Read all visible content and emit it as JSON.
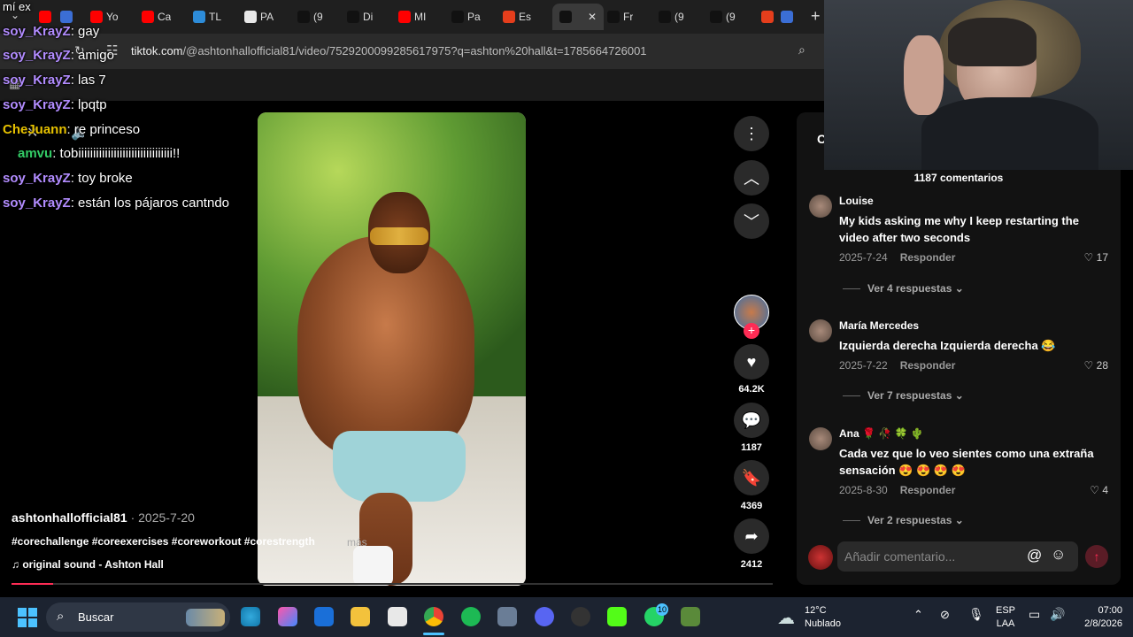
{
  "browser": {
    "tabs": [
      {
        "label": "",
        "color": "#ff0000"
      },
      {
        "label": "",
        "color": "#3b6ed5"
      },
      {
        "label": "Yo",
        "color": "#ff0000"
      },
      {
        "label": "Ca",
        "color": "#ff0000"
      },
      {
        "label": "TL",
        "color": "#2d8cd9"
      },
      {
        "label": "PA",
        "color": "#e8e8e8"
      },
      {
        "label": "(9",
        "color": "#111111"
      },
      {
        "label": "Di",
        "color": "#111111"
      },
      {
        "label": "MI",
        "color": "#ff0000"
      },
      {
        "label": "Pa",
        "color": "#111111"
      },
      {
        "label": "Es",
        "color": "#e53e1c"
      },
      {
        "label": "",
        "color": "#111111"
      },
      {
        "label": "Fr",
        "color": "#111111"
      },
      {
        "label": "(9",
        "color": "#111111"
      },
      {
        "label": "(9",
        "color": "#111111"
      },
      {
        "label": "",
        "color": "#e53e1c"
      },
      {
        "label": "",
        "color": "#3b6ed5"
      }
    ],
    "url_host": "tiktok.com",
    "url_path": "/@ashtonhallofficial81/video/7529200099285617975?q=ashton%20hall&t=1785664726001"
  },
  "chat": [
    {
      "user": "mí ex",
      "text": "",
      "color": "#ffffff"
    },
    {
      "user": "soy_KrayZ",
      "text": ": gay",
      "color": "#b28cff"
    },
    {
      "user": "soy_KrayZ",
      "text": ": amigo",
      "color": "#b28cff"
    },
    {
      "user": "soy_KrayZ",
      "text": ": las 7",
      "color": "#b28cff"
    },
    {
      "user": "soy_KrayZ",
      "text": ": lpqtp",
      "color": "#b28cff"
    },
    {
      "user": "CheJuann",
      "text": ": re princeso",
      "color": "#e6c100"
    },
    {
      "user": "amvu",
      "text": ": tobiiiiiiiiiiiiiiiiiiiiiiiiiiiiiiii!!",
      "color": "#33cc66"
    },
    {
      "user": "soy_KrayZ",
      "text": ": toy broke",
      "color": "#b28cff"
    },
    {
      "user": "soy_KrayZ",
      "text": ": están los pájaros cantndo",
      "color": "#b28cff"
    }
  ],
  "video": {
    "author": "ashtonhallofficial81",
    "date": " · 2025-7-20",
    "hashtags": "#corechallenge #coreexercises #coreworkout #corestrength",
    "more": "más",
    "sound": "original sound - Ashton Hall",
    "progress": 0.055
  },
  "actions": {
    "likes": "64.2K",
    "comments": "1187",
    "saves": "4369",
    "shares": "2412"
  },
  "comments_panel": {
    "header_letter": "C",
    "count_label": "1187 comentarios",
    "items": [
      {
        "user": "Louise",
        "text": "My kids asking me why I keep restarting the video after two seconds",
        "date": "2025-7-24",
        "reply": "Responder",
        "likes": "17",
        "more": "Ver 4 respuestas ⌄"
      },
      {
        "user": "María Mercedes",
        "text": "Izquierda derecha Izquierda derecha 😂",
        "date": "2025-7-22",
        "reply": "Responder",
        "likes": "28",
        "more": "Ver 7 respuestas ⌄"
      },
      {
        "user": "Ana 🌹 🥀 🍀 🌵",
        "text": "Cada vez que lo veo sientes como una extraña sensación 😍 😍 😍 😍",
        "date": "2025-8-30",
        "reply": "Responder",
        "likes": "4",
        "more": "Ver 2 respuestas ⌄"
      }
    ],
    "input_placeholder": "Añadir comentario..."
  },
  "taskbar": {
    "search_label": "Buscar",
    "weather_temp": "12°C",
    "weather_desc": "Nublado",
    "lang": "ESP",
    "lang_sub": "LAA",
    "time": "07:00",
    "date": "2/8/2026",
    "whatsapp_badge": "10"
  }
}
